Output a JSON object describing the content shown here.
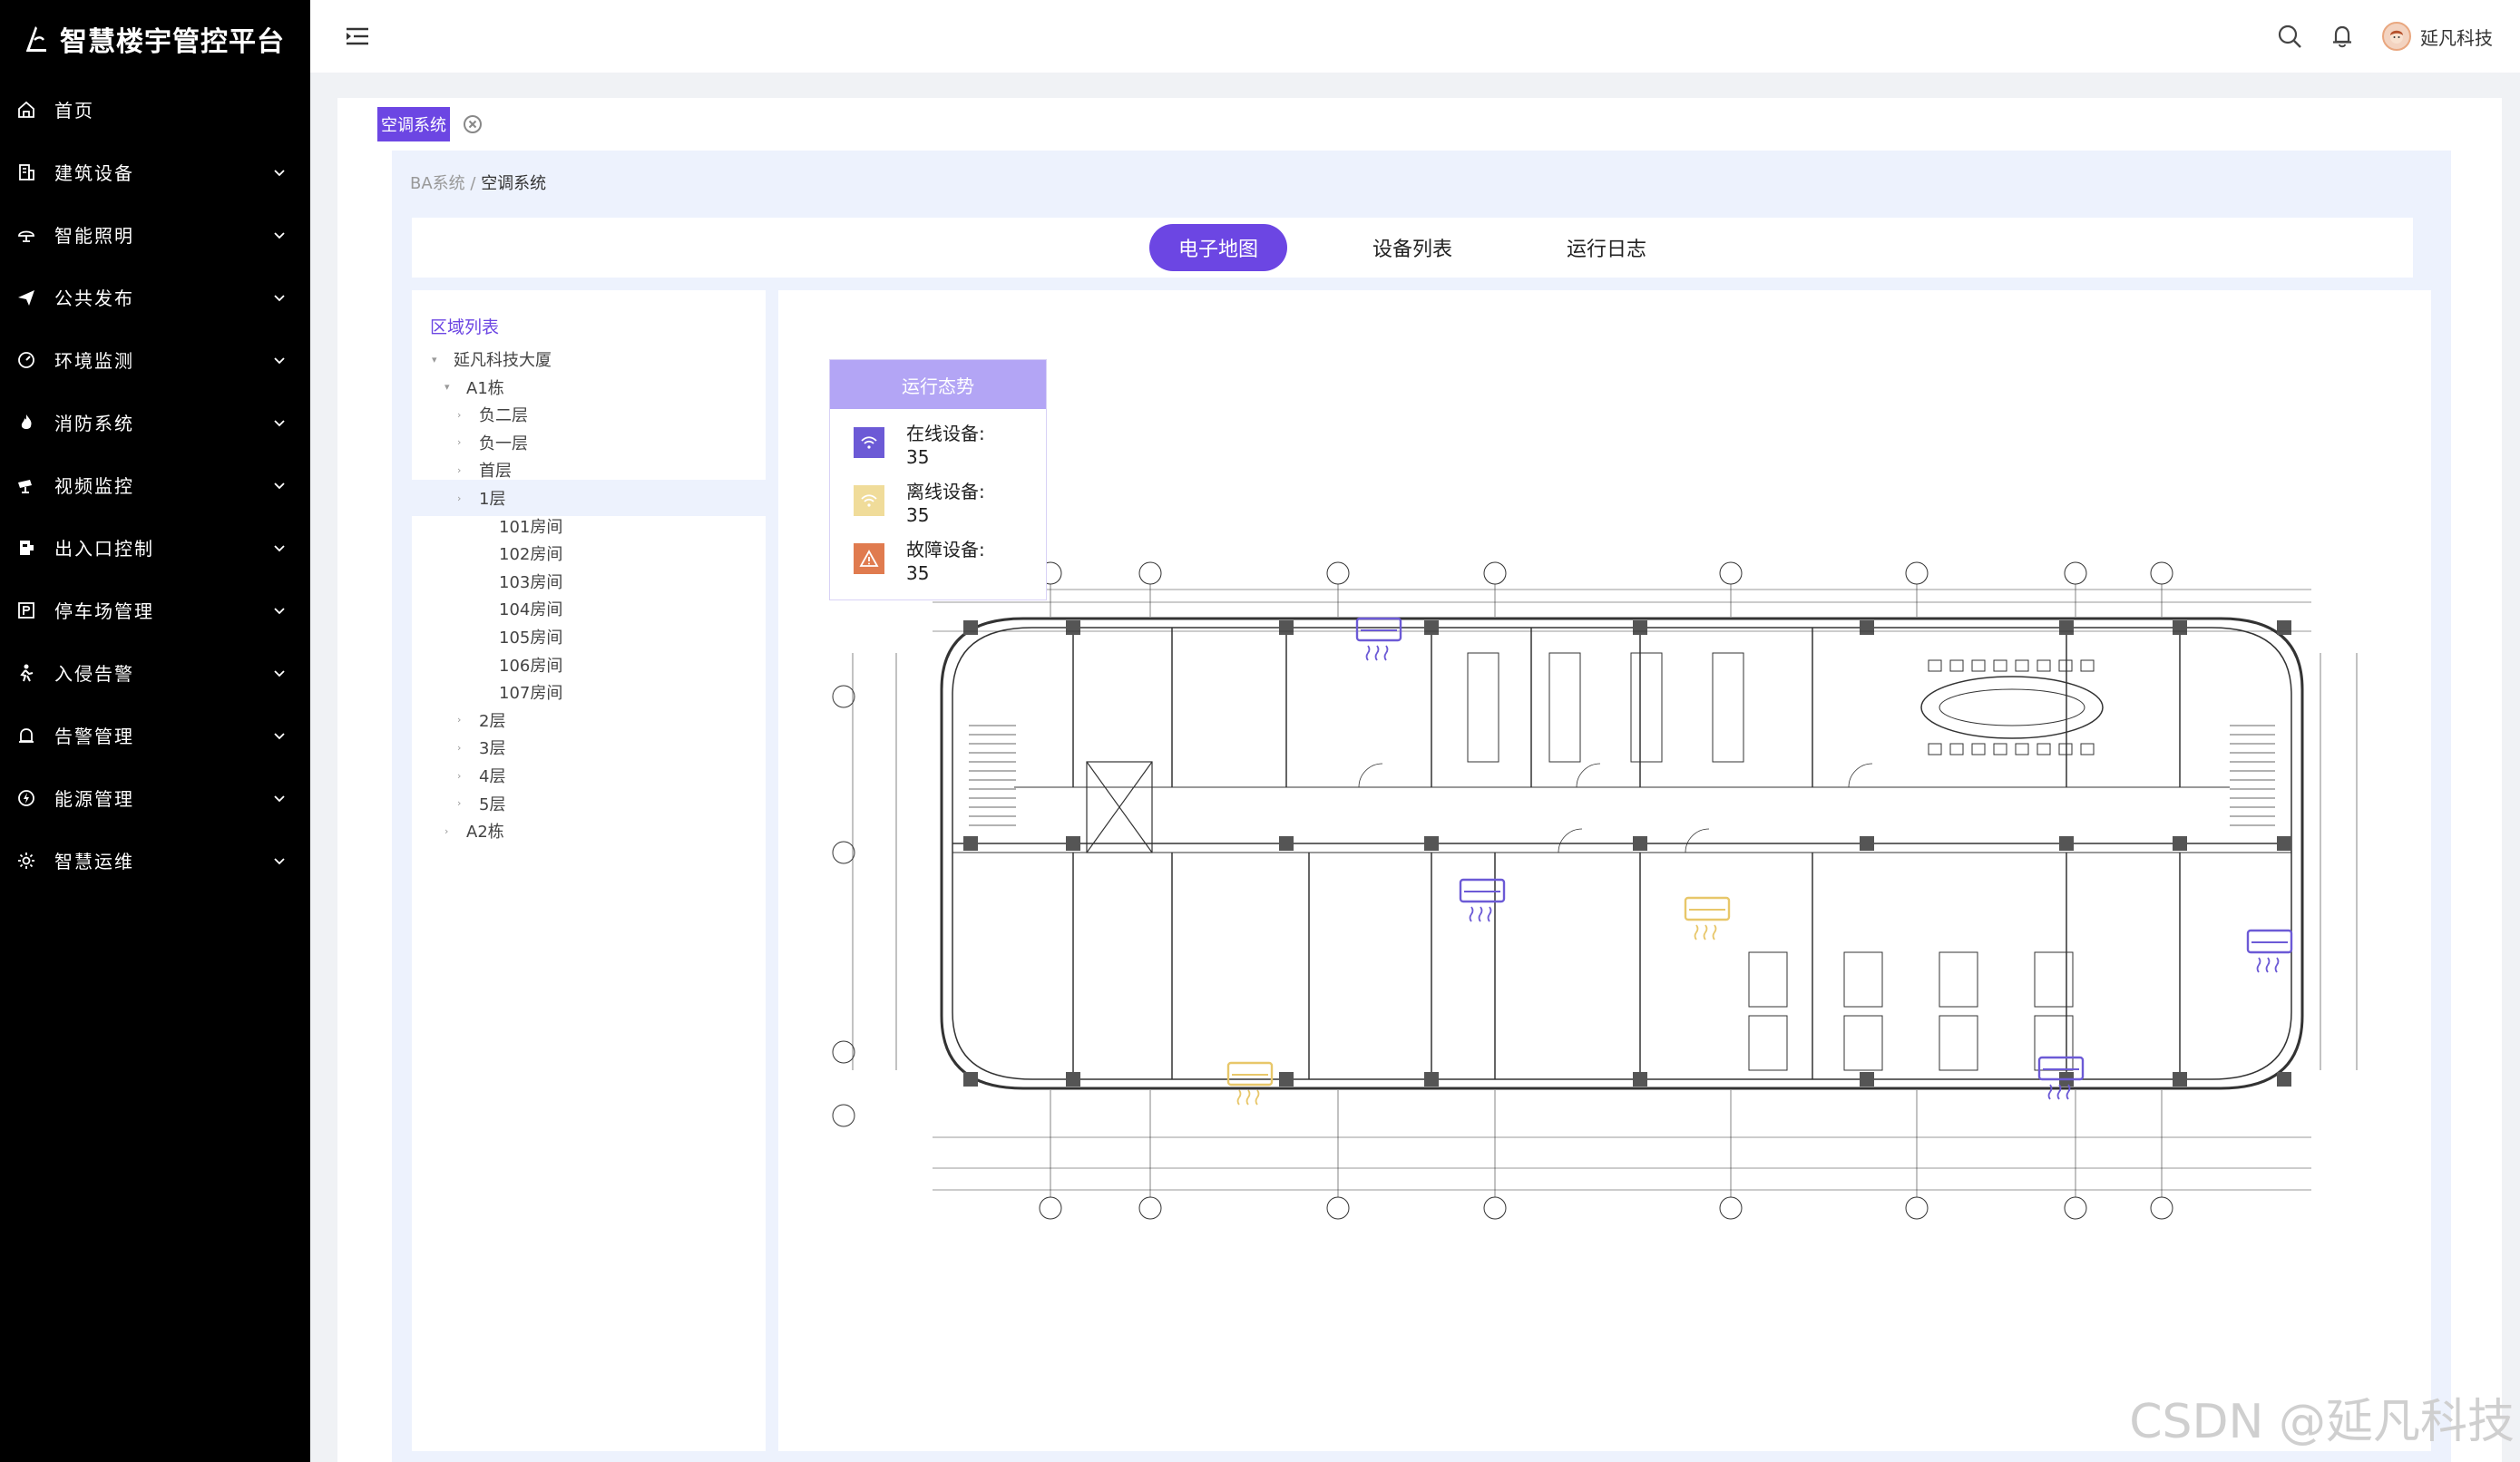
{
  "app": {
    "title": "智慧楼宇管控平台"
  },
  "sidebar": {
    "items": [
      {
        "label": "首页",
        "icon": "home-icon"
      },
      {
        "label": "建筑设备",
        "icon": "building-icon"
      },
      {
        "label": "智能照明",
        "icon": "lamp-icon"
      },
      {
        "label": "公共发布",
        "icon": "send-icon"
      },
      {
        "label": "环境监测",
        "icon": "gauge-icon"
      },
      {
        "label": "消防系统",
        "icon": "fire-icon"
      },
      {
        "label": "视频监控",
        "icon": "camera-icon"
      },
      {
        "label": "出入口控制",
        "icon": "door-icon"
      },
      {
        "label": "停车场管理",
        "icon": "parking-icon"
      },
      {
        "label": "入侵告警",
        "icon": "intruder-icon"
      },
      {
        "label": "告警管理",
        "icon": "alarm-icon"
      },
      {
        "label": "能源管理",
        "icon": "energy-icon"
      },
      {
        "label": "智慧运维",
        "icon": "ops-icon"
      }
    ]
  },
  "header": {
    "user_name": "延凡科技"
  },
  "tags": {
    "active": "空调系统"
  },
  "breadcrumb": {
    "parent": "BA系统 /",
    "current": "空调系统"
  },
  "tabs": [
    "电子地图",
    "设备列表",
    "运行日志"
  ],
  "area": {
    "title": "区域列表",
    "tree": [
      {
        "label": "延凡科技大厦",
        "level": 1,
        "caret": "▾"
      },
      {
        "label": "A1栋",
        "level": 2,
        "caret": "▾"
      },
      {
        "label": "负二层",
        "level": 3,
        "caret": "›"
      },
      {
        "label": "负一层",
        "level": 3,
        "caret": "›"
      },
      {
        "label": "首层",
        "level": 3,
        "caret": "›"
      },
      {
        "label": "1层",
        "level": 3,
        "caret": "›"
      },
      {
        "label": "101房间",
        "level": 4,
        "caret": ""
      },
      {
        "label": "102房间",
        "level": 4,
        "caret": ""
      },
      {
        "label": "103房间",
        "level": 4,
        "caret": ""
      },
      {
        "label": "104房间",
        "level": 4,
        "caret": ""
      },
      {
        "label": "105房间",
        "level": 4,
        "caret": ""
      },
      {
        "label": "106房间",
        "level": 4,
        "caret": ""
      },
      {
        "label": "107房间",
        "level": 4,
        "caret": ""
      },
      {
        "label": "2层",
        "level": 3,
        "caret": "›"
      },
      {
        "label": "3层",
        "level": 3,
        "caret": "›"
      },
      {
        "label": "4层",
        "level": 3,
        "caret": "›"
      },
      {
        "label": "5层",
        "level": 3,
        "caret": "›"
      },
      {
        "label": "A2栋",
        "level": 2,
        "caret": "›"
      }
    ]
  },
  "status": {
    "title": "运行态势",
    "online_label": "在线设备:",
    "online_count": "35",
    "offline_label": "离线设备:",
    "offline_count": "35",
    "fault_label": "故障设备:",
    "fault_count": "35"
  },
  "colors": {
    "accent": "#6c46e3",
    "online": "#6c5ad6",
    "offline": "#e8c76a",
    "fault": "#e07b4f"
  },
  "watermark": "CSDN @延凡科技"
}
